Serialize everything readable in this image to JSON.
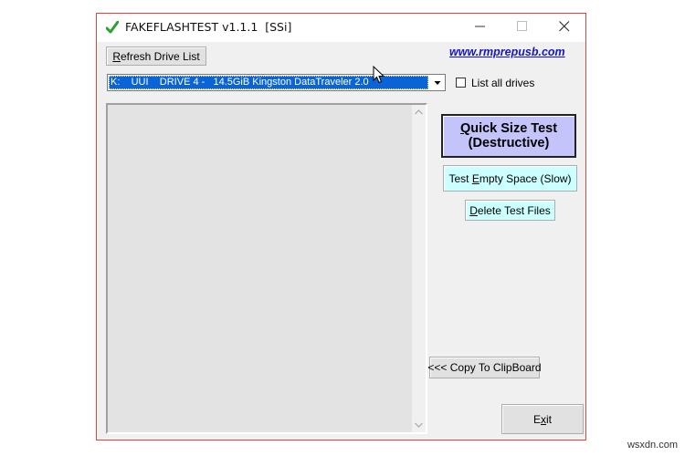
{
  "window": {
    "title": "FAKEFLASHTEST v1.1.1  [SSi]",
    "title_icon": "checkmark-icon",
    "buttons": {
      "minimize": "minimize-icon",
      "maximize": "maximize-icon",
      "close": "close-icon"
    }
  },
  "toolbar": {
    "refresh_hotkey": "R",
    "refresh_rest": "efresh Drive List",
    "website": "www.rmprepusb.com"
  },
  "drive_select": {
    "selected": "K:    UUI    DRIVE 4 -   14.5GiB Kingston DataTraveler 2.0"
  },
  "list_all_drives": {
    "label": "List all drives",
    "checked": false
  },
  "actions": {
    "quick_hotkey": "Q",
    "quick_rest": "uick Size Test",
    "quick_line2": "(Destructive)",
    "empty_pre": "Test ",
    "empty_hotkey": "E",
    "empty_rest": "mpty Space (Slow)",
    "delete_hotkey": "D",
    "delete_rest": "elete Test Files",
    "copy_label": "<<< Copy To ClipBoard",
    "exit_pre": "E",
    "exit_hotkey": "x",
    "exit_rest": "it"
  },
  "colors": {
    "quick_button": "#c4c4fb",
    "empty_button": "#ccffff",
    "delete_button": "#ccffff",
    "selection": "#0a64d6",
    "link": "#1515c8"
  },
  "watermark": "wsxdn.com"
}
